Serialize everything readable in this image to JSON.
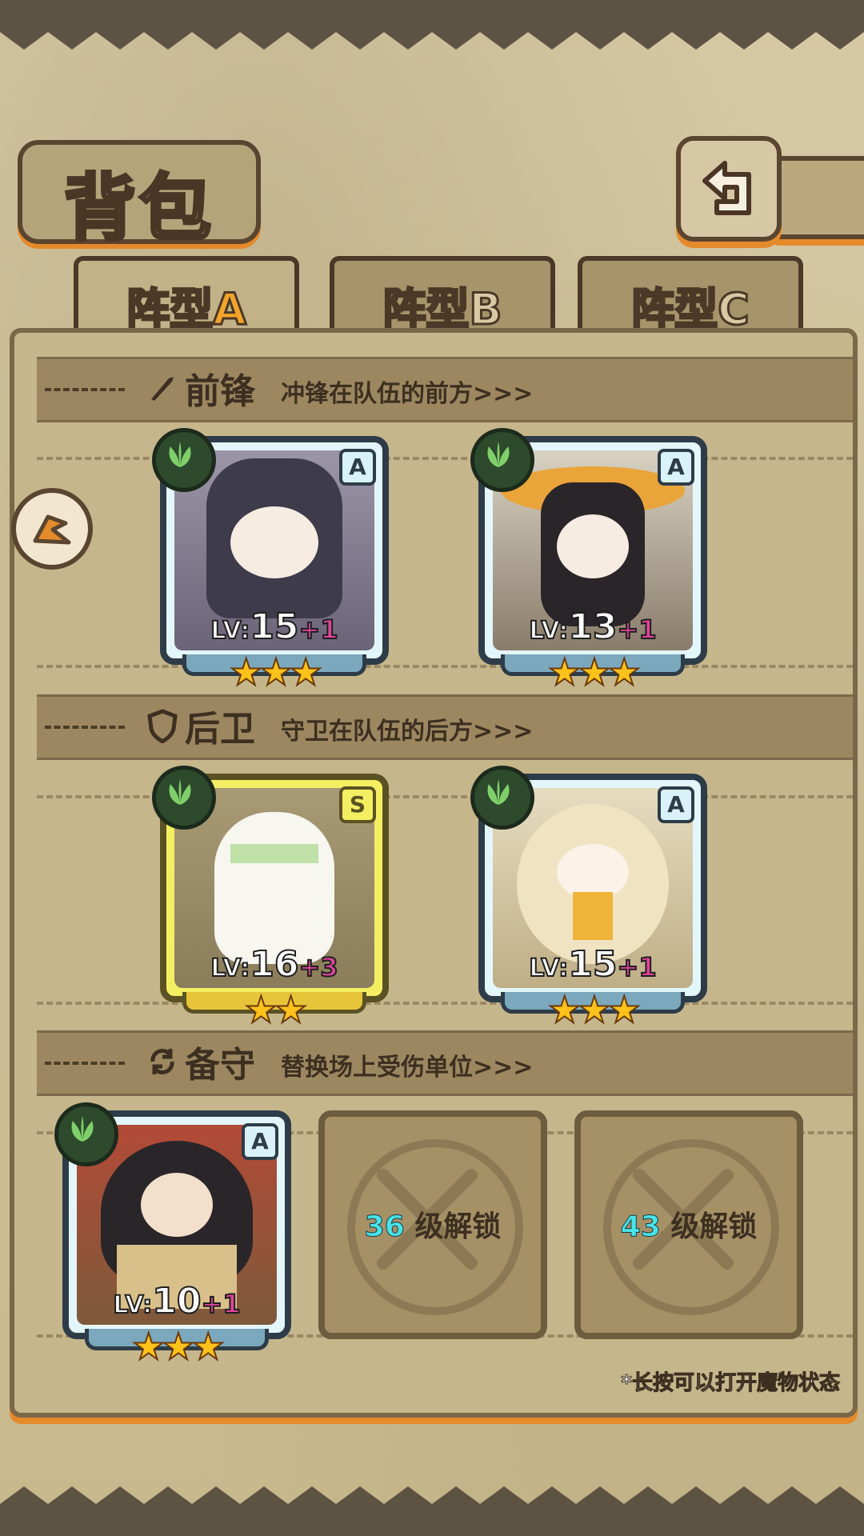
{
  "title": "背包",
  "tabs": [
    {
      "prefix": "阵型",
      "letter": "A",
      "active": true
    },
    {
      "prefix": "阵型",
      "letter": "B",
      "active": false
    },
    {
      "prefix": "阵型",
      "letter": "C",
      "active": false
    }
  ],
  "sections": {
    "front": {
      "name": "前锋",
      "desc": "冲锋在队伍的前方>>>",
      "icon": "sword-icon"
    },
    "back": {
      "name": "后卫",
      "desc": "守卫在队伍的后方>>>",
      "icon": "shield-icon"
    },
    "reserve": {
      "name": "备守",
      "desc": "替换场上受伤单位>>>",
      "icon": "swap-icon"
    }
  },
  "cards": [
    {
      "rank": "A",
      "lv_prefix": "LV:",
      "lv": "15",
      "plus": "+1",
      "stars": "★★★",
      "element": "leaf-icon"
    },
    {
      "rank": "A",
      "lv_prefix": "LV:",
      "lv": "13",
      "plus": "+1",
      "stars": "★★★",
      "element": "leaf-icon"
    },
    {
      "rank": "S",
      "lv_prefix": "LV:",
      "lv": "16",
      "plus": "+3",
      "stars": "★★",
      "element": "leaf-icon"
    },
    {
      "rank": "A",
      "lv_prefix": "LV:",
      "lv": "15",
      "plus": "+1",
      "stars": "★★★",
      "element": "leaf-icon"
    },
    {
      "rank": "A",
      "lv_prefix": "LV:",
      "lv": "10",
      "plus": "+1",
      "stars": "★★★",
      "element": "leaf-icon"
    }
  ],
  "locked": [
    {
      "level": "36",
      "text": " 级解锁"
    },
    {
      "level": "43",
      "text": " 级解锁"
    }
  ],
  "hint": "*长按可以打开魔物状态",
  "colors": {
    "accent": "#e58a2a",
    "frame": "#5a4530",
    "plus": "#e0449b",
    "unlock": "#47e4e8"
  }
}
